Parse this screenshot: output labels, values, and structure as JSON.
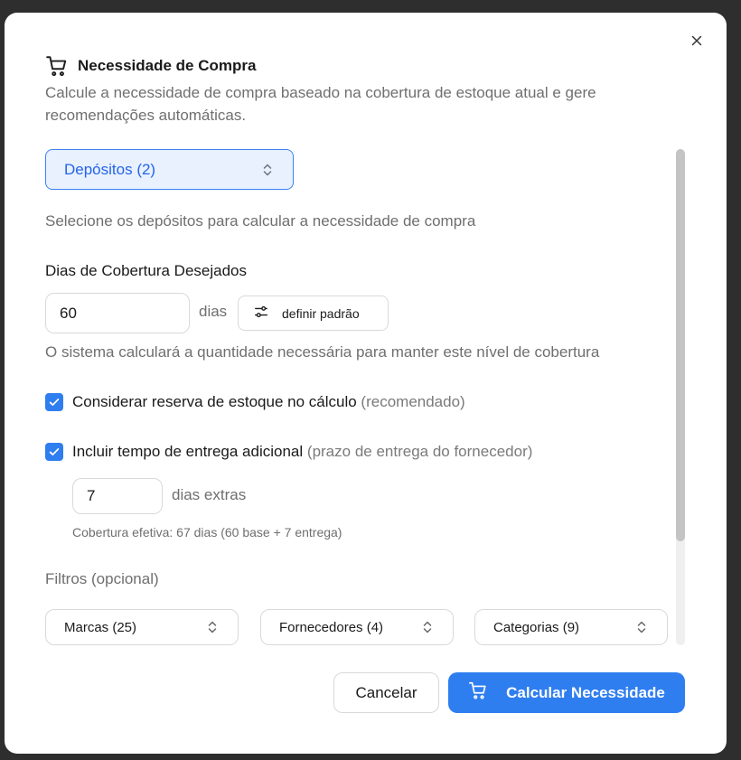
{
  "dialog": {
    "title": "Necessidade de Compra",
    "subtitle": "Calcule a necessidade de compra baseado na cobertura de estoque atual e gere recomendações automáticas."
  },
  "warehouses": {
    "select_label": "Depósitos (2)",
    "help": "Selecione os depósitos para calcular a necessidade de compra"
  },
  "coverage": {
    "label": "Dias de Cobertura Desejados",
    "value": "60",
    "unit": "dias",
    "default_button": "definir padrão",
    "help": "O sistema calculará a quantidade necessária para manter este nível de cobertura"
  },
  "options": {
    "reserve": {
      "checked": true,
      "label": "Considerar reserva de estoque no cálculo",
      "hint": "(recomendado)"
    },
    "lead_time": {
      "checked": true,
      "label": "Incluir tempo de entrega adicional",
      "hint": "(prazo de entrega do fornecedor)",
      "extra_days_value": "7",
      "extra_days_unit": "dias extras",
      "effective_note": "Cobertura efetiva: 67 dias (60 base + 7 entrega)"
    }
  },
  "filters": {
    "label": "Filtros (opcional)",
    "brands": "Marcas (25)",
    "suppliers": "Fornecedores (4)",
    "categories": "Categorias (9)"
  },
  "footer": {
    "cancel": "Cancelar",
    "submit": "Calcular Necessidade"
  },
  "icons": {
    "title": "shopping-cart-icon",
    "close": "close-icon",
    "select": "chevron-up-down-icon",
    "default": "sliders-icon",
    "submit": "shopping-cart-icon"
  },
  "colors": {
    "accent": "#2f7ef0",
    "selected_bg": "#e8f1fd"
  }
}
